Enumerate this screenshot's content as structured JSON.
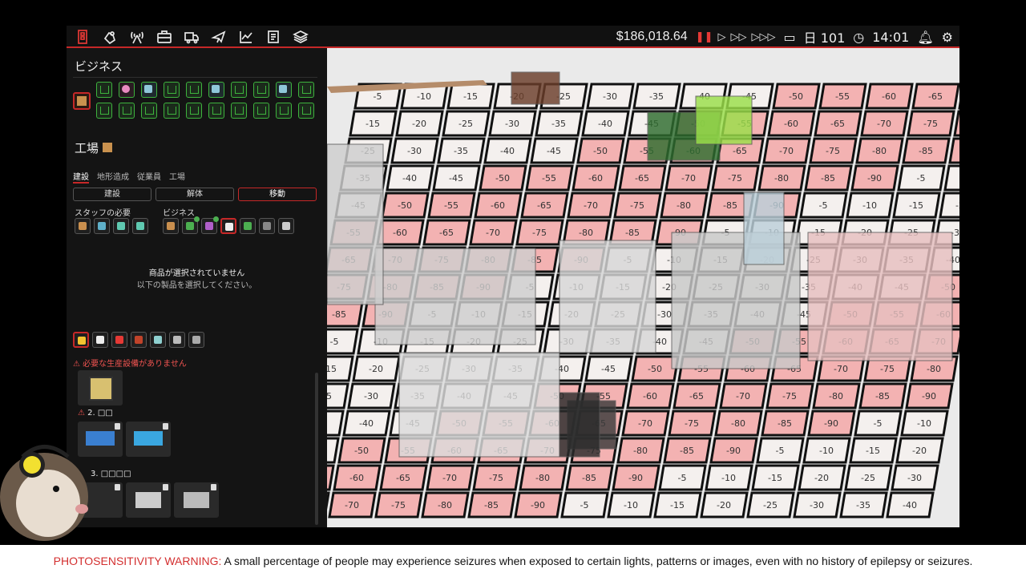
{
  "topbar": {
    "money": "186,018.64",
    "currency_symbol": "$",
    "day": "日 101",
    "time": "14:01",
    "icons": [
      "building-icon",
      "hand-icon",
      "signal-icon",
      "briefcase-icon",
      "truck-icon",
      "plane-icon",
      "chart-icon",
      "book-icon",
      "layers-icon"
    ]
  },
  "sidebar": {
    "business_title": "ビジネス",
    "factory_title": "工場",
    "tabs": [
      "建設",
      "地形造成",
      "従業員",
      "工場"
    ],
    "actions": [
      "建設",
      "解体",
      "移動"
    ],
    "staff_needed_label": "スタッフの必要",
    "business_label": "ビジネス",
    "no_product_title": "商品が選択されていません",
    "no_product_sub": "以下の製品を選択してください。",
    "warning": "必要な生産設備がありません",
    "items": [
      {
        "num": "2. □□"
      },
      {
        "num": "3. □□□□"
      }
    ]
  },
  "map": {
    "cell_values": [
      "-5",
      "-10",
      "-15",
      "-20",
      "-25",
      "-30",
      "-35",
      "-40",
      "-45",
      "-50",
      "-55",
      "-60",
      "-65",
      "-70",
      "-75",
      "-80",
      "-85",
      "-90"
    ]
  },
  "footer": {
    "warning_label": "PHOTOSENSITIVITY WARNING:",
    "warning_text": "A small percentage of people may experience seizures when exposed to certain lights, patterns or images, even with no history of epilepsy or seizures."
  }
}
